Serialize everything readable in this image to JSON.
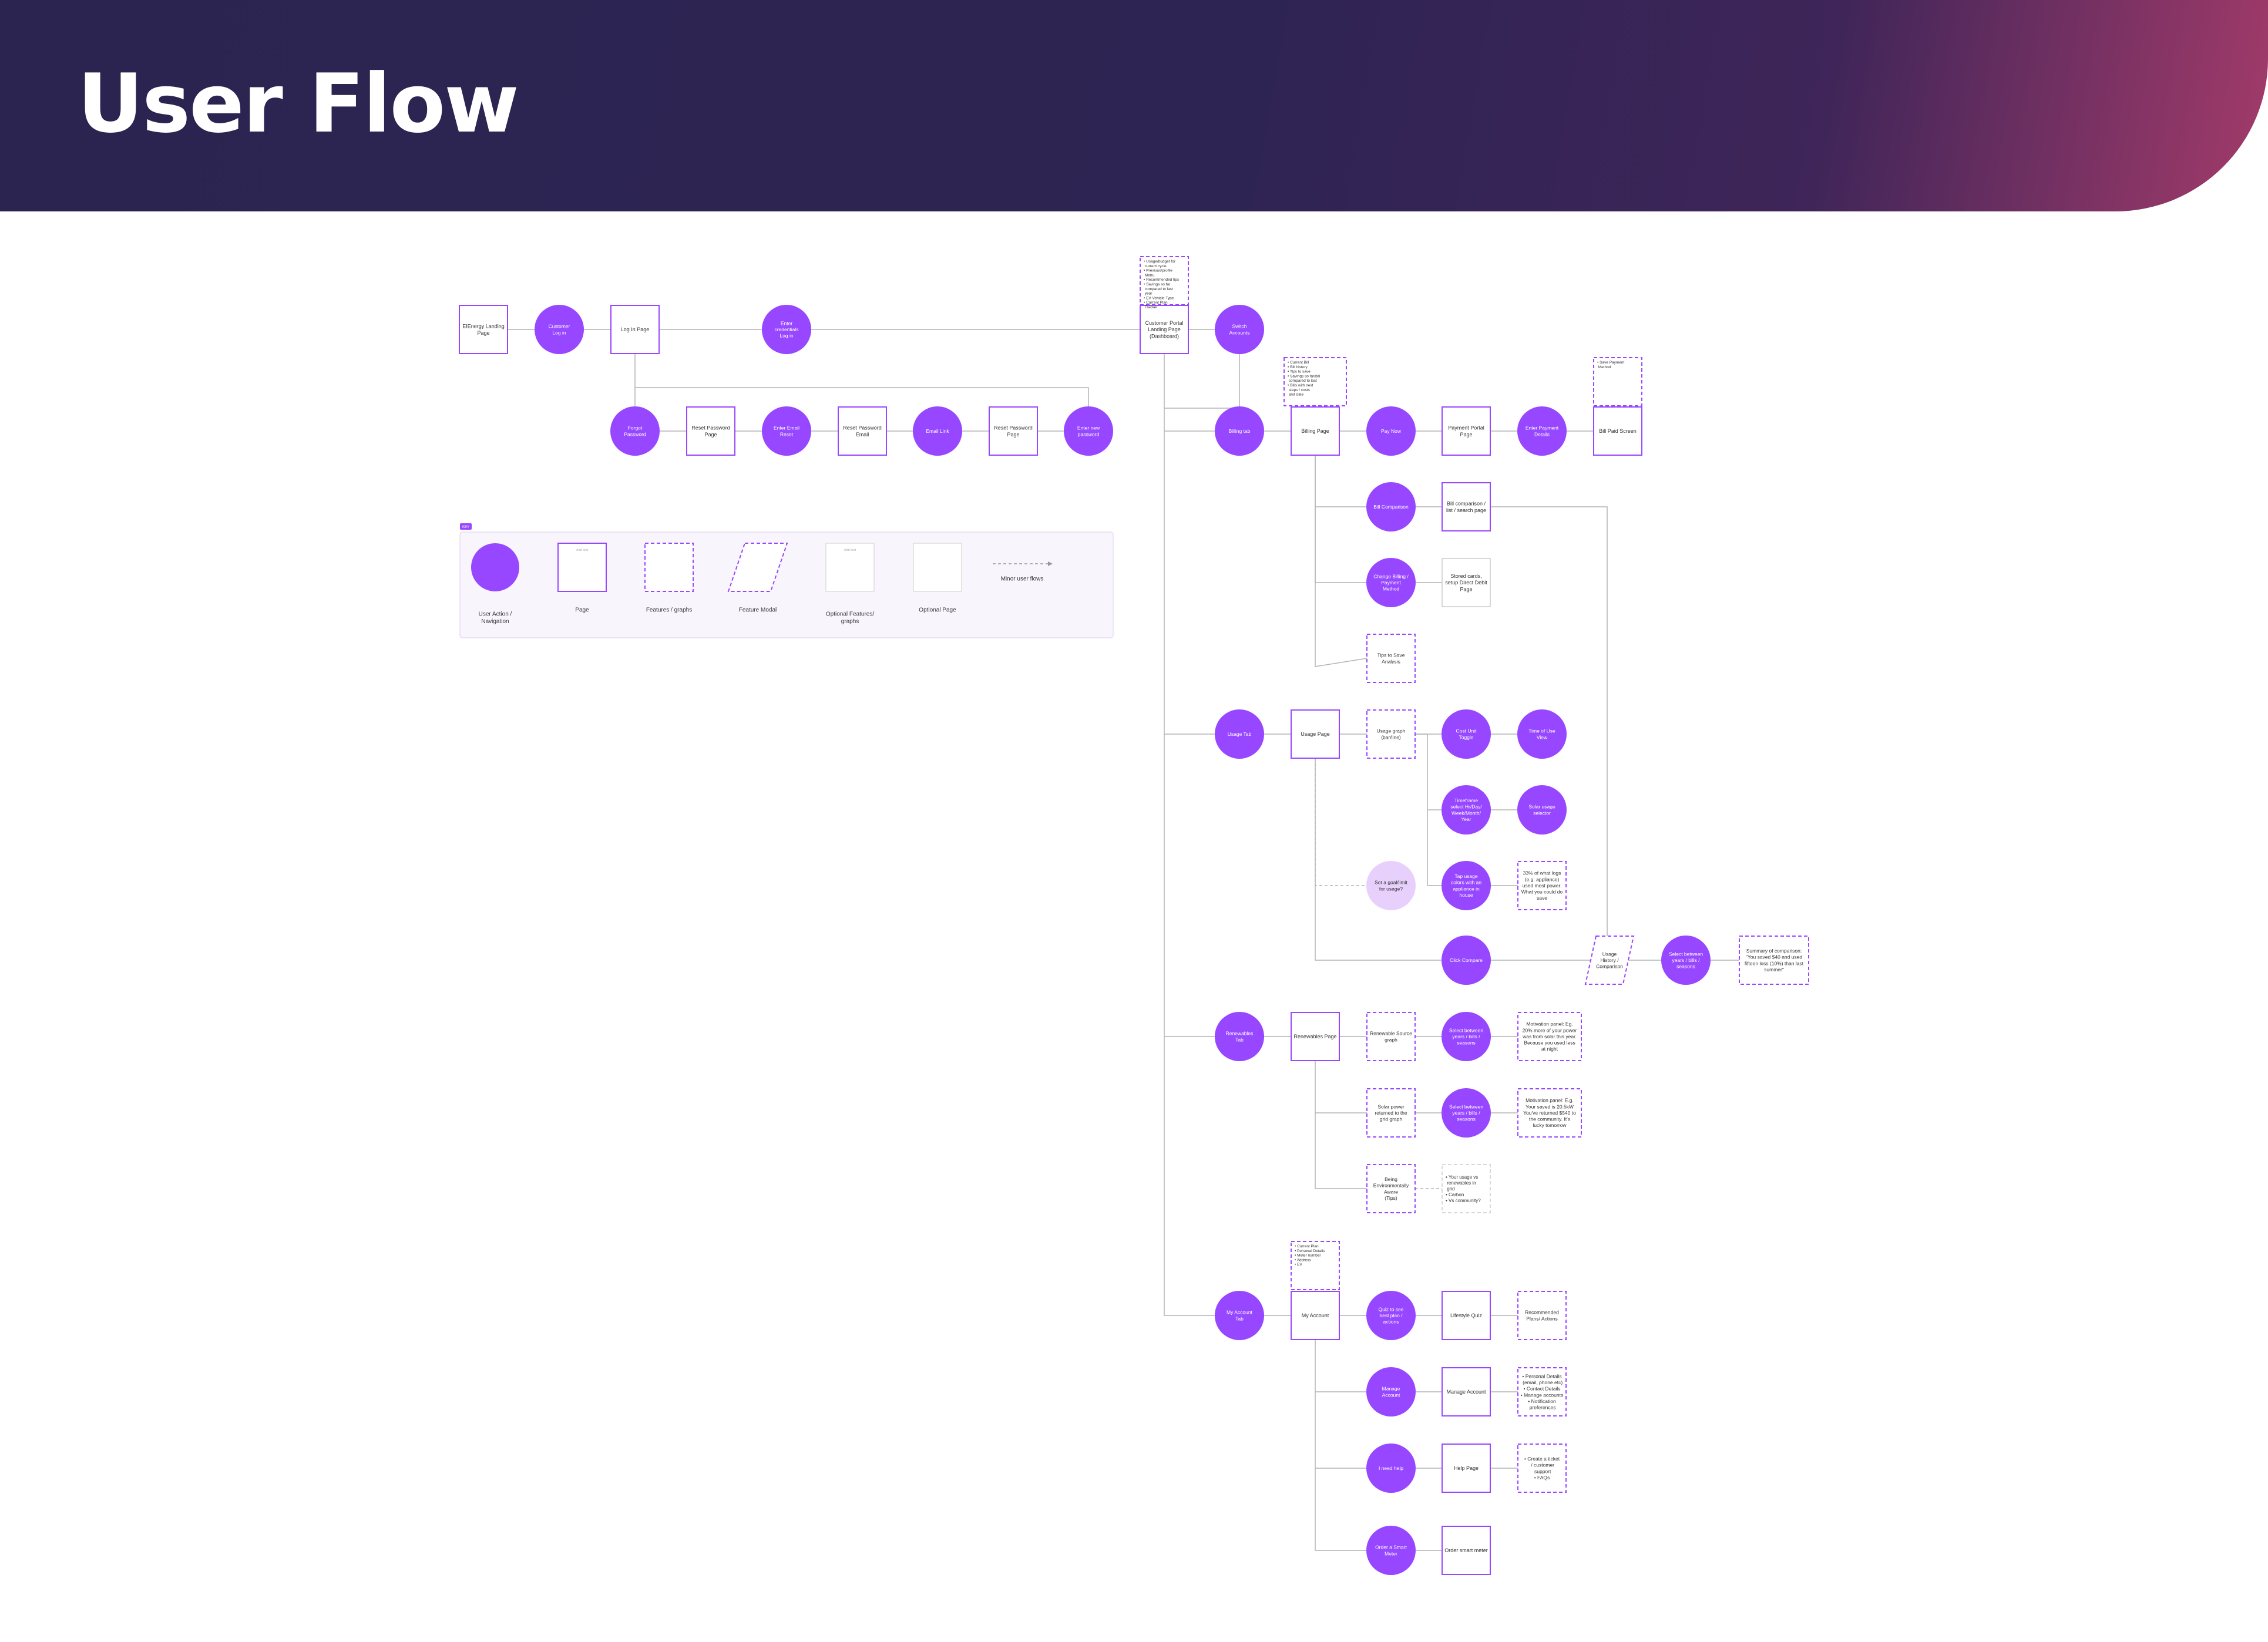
{
  "header": {
    "title": "User Flow"
  },
  "colors": {
    "accent": "#9747ff",
    "light_accent": "#e8d0fc",
    "line": "#b3b3b3",
    "header_dark": "#2e2453",
    "header_pink": "#a33b6a"
  },
  "legend": {
    "tag": "KEY",
    "items": [
      {
        "label": "User Action /\nNavigation"
      },
      {
        "label": "Page",
        "placeholder": "Add text"
      },
      {
        "label": "Features / graphs"
      },
      {
        "label": "Feature Modal"
      },
      {
        "label": "Optional Features/\ngraphs",
        "placeholder": "Add text"
      },
      {
        "label": "Optional Page"
      },
      {
        "label": "Minor user flows"
      }
    ]
  },
  "nodes": {
    "landing": "EIEnergy Landing\nPage",
    "customer_login": "Customer\nLog in",
    "login_page": "Log In Page",
    "enter_credentials": "Enter\ncredentials\nLog in",
    "portal_notes": "• Usage/budget for\n  current cycle\n• Previous/profile\n  Menu\n• Recommended tips\n• Savings so far\n  compared to last\n  year\n• EV Vehicle Type\n• Current Plan\n  Tracker",
    "portal_landing": "Customer Portal\nLanding Page\n(Dashboard)",
    "switch_accounts": "Switch\nAccounts",
    "forgot_password": "Forgot\nPassword",
    "reset_pw_page": "Reset Password\nPage",
    "enter_email_reset": "Enter Email\nReset",
    "reset_pw_email": "Reset Password\nEmail",
    "email_link": "Email Link",
    "reset_pw_page2": "Reset Password\nPage",
    "enter_new_pw": "Enter new\npassword",
    "billing_notes": "• Current Bill\n• Bill history\n• Tips to save\n• Savings so far/bill\n  compared to last\n• Bills with next\n  steps / costs\n  and date",
    "billing_tab": "Billing tab",
    "billing_page": "Billing Page",
    "pay_now": "Pay Now",
    "payment_portal": "Payment Portal\nPage",
    "enter_payment": "Enter Payment\nDetails",
    "save_payment_note": "• Save Payment\n  Method",
    "bill_paid": "Bill Paid Screen",
    "bill_comparison": "Bill Comparison",
    "bill_comparison_page": "Bill comparison /\nlist / search page",
    "change_billing": "Change Billing /\nPayment\nMethod",
    "stored_cards": "Stored cards,\nsetup Direct Debit\nPage",
    "tips_to_save": "Tips to Save\nAnalysis",
    "usage_tab": "Usage Tab",
    "usage_page": "Usage Page",
    "usage_graph": "Usage graph\n(bar/line)",
    "cost_unit_toggle": "Cost Unit\nToggle",
    "time_of_use": "Time of Use\nView",
    "timeframe": "Timeframe\nselect Hr/Day/\nWeek/Month/\nYear",
    "solar_usage": "Solar usage\nselector",
    "tap_usage": "Tap usage\ncolors with an\nappliance in\nhouse",
    "appliance_note": "33% of what logs\n(e.g. appliance)\nused most power.\nWhat you could do\nsave",
    "set_goal": "Set a goal/limit\nfor usage?",
    "click_compare": "Click Compare",
    "usage_history": "Usage\nHistory /\nComparison",
    "select_years": "Select between\nyears / bills /\nseasons",
    "summary_comparison": "Summary of comparison:\n\"You saved $40 and used\nfifteen less (10%) than last\nsummer\"",
    "renewables_tab": "Renewables\nTab",
    "renewables_page": "Renewables Page",
    "renewable_graph": "Renewable Source\ngraph",
    "select_years_2": "Select between\nyears / bills /\nseasons",
    "motivation_1": "Motivation panel: Eg.\n20% more of your power\nwas from solar this year.\nBecause you used less\nat night",
    "solar_returned": "Solar power\nreturned to the\ngrid graph",
    "select_years_3": "Select between\nyears / bills /\nseasons",
    "motivation_2": "Motivation panel: E.g.\nYour saved is 20.5kW\nYou've returned $540 to\nthe community. It's\nlucky tomorrow",
    "env_awards": "Being\nEnvironmentally\nAware\n(Tips)",
    "env_note": "• Your usage vs\n  renewables in\n  grid\n• Carbon\n• Vs community?",
    "account_notes": "• Current Plan\n• Personal Details\n• Meter number\n• Address\n• EV",
    "my_account_tab": "My Account\nTab",
    "my_account": "My Account",
    "quiz": "Quiz to see\nbest plan /\nactions",
    "lifestyle_quiz": "Lifestyle Quiz",
    "recommended": "Recommended\nPlans/ Actions",
    "manage_account": "Manage\nAccount",
    "manage_account_page": "Manage Account",
    "manage_notes": "• Personal Details\n  (email, phone etc)\n• Contact Details\n• Manage accounts\n• Notification\n  preferences",
    "need_help": "I need help",
    "help_page": "Help Page",
    "help_notes": "• Create a ticket\n  / customer\n  support\n• FAQs",
    "order_smart": "Order a Smart\nMeter",
    "order_smart_page": "Order smart meter"
  }
}
